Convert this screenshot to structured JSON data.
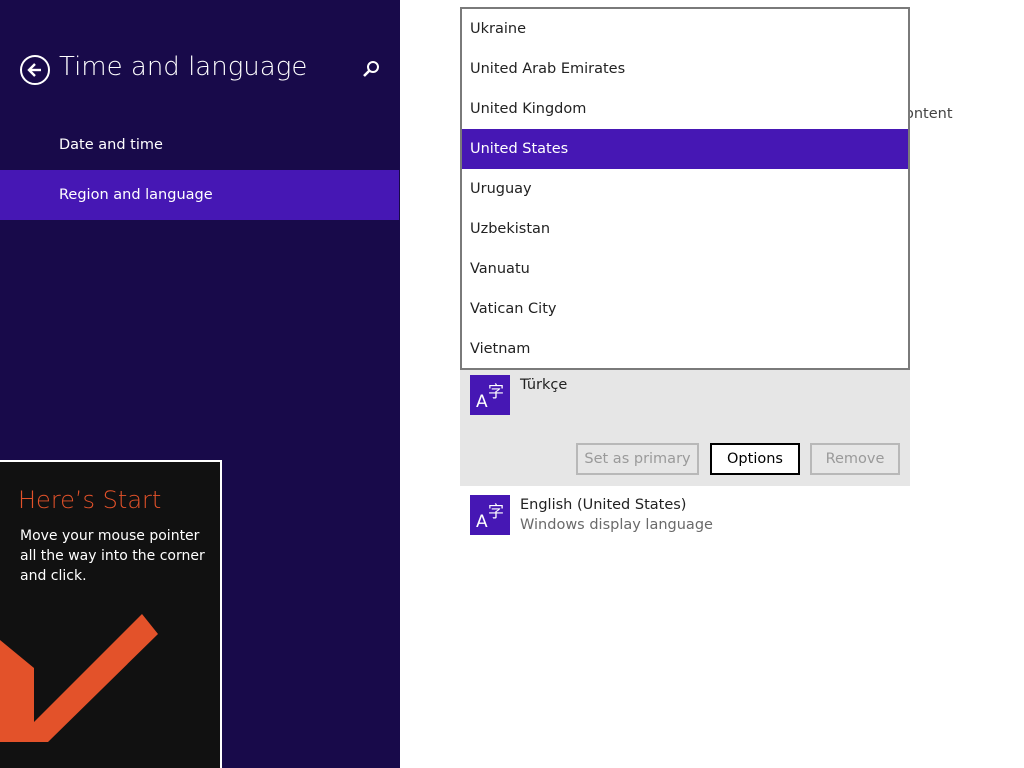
{
  "left_pane": {
    "title": "Time and language",
    "nav_items": [
      {
        "label": "Date and time",
        "selected": false
      },
      {
        "label": "Region and language",
        "selected": true
      }
    ]
  },
  "start_tip": {
    "title": "Here’s Start",
    "body": "Move your mouse pointer all the way into the corner and click."
  },
  "background_text": "ontent",
  "country_dropdown": {
    "items": [
      "Ukraine",
      "United Arab Emirates",
      "United Kingdom",
      "United States",
      "Uruguay",
      "Uzbekistan",
      "Vanuatu",
      "Vatican City",
      "Vietnam"
    ],
    "selected": "United States"
  },
  "languages": [
    {
      "name": "Türkçe",
      "subtitle": ""
    },
    {
      "name": "English (United States)",
      "subtitle": "Windows display language"
    }
  ],
  "language_actions": {
    "set_primary": "Set as primary",
    "options": "Options",
    "remove": "Remove"
  },
  "colors": {
    "pane_bg": "#180a4a",
    "accent": "#4617b4",
    "tip_title": "#e3522a",
    "tip_arrow": "#e3522a"
  },
  "icons": {
    "back": "back-arrow-circle-icon",
    "search": "search-icon",
    "language": "language-icon",
    "tip_arrow": "arrow-down-left-icon"
  }
}
